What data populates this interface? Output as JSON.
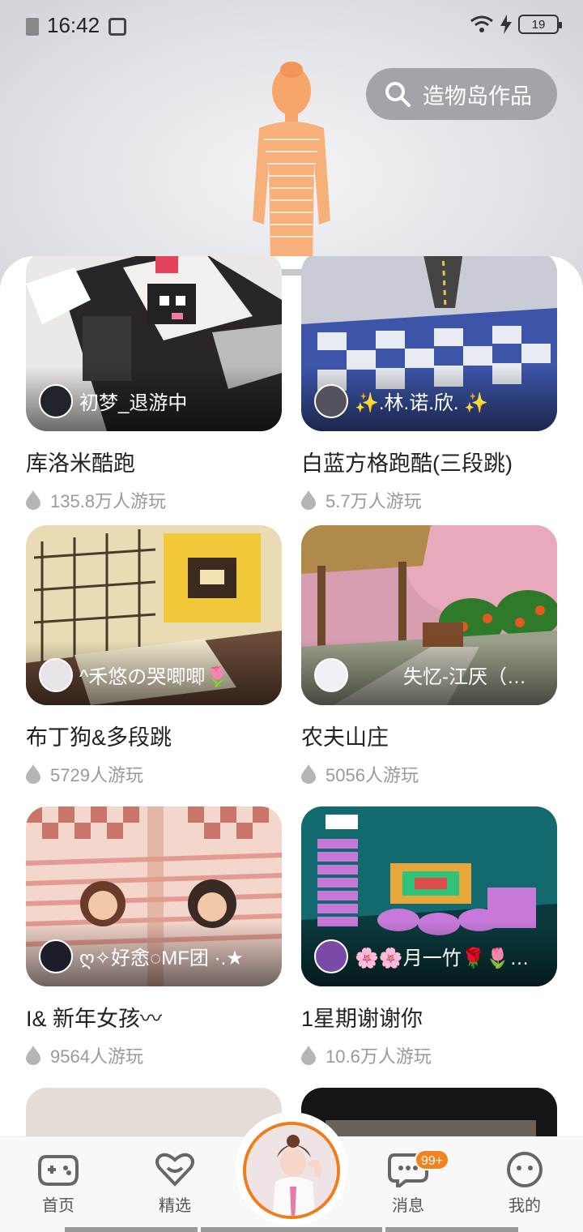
{
  "status_bar": {
    "time": "16:42",
    "battery": "19"
  },
  "search": {
    "label": "造物岛作品"
  },
  "cards": [
    {
      "title": "库洛米酷跑",
      "author": "初梦_退游中",
      "plays": "135.8万人游玩"
    },
    {
      "title": "白蓝方格跑酷(三段跳)",
      "author": "✨.林.诺.欣. ✨",
      "plays": "5.7万人游玩"
    },
    {
      "title": "布丁狗&多段跳",
      "author": "^禾悠の哭唧唧🌷",
      "plays": "5729人游玩"
    },
    {
      "title": "农夫山庄",
      "author": "失忆-江厌（…",
      "plays": "5056人游玩"
    },
    {
      "title": "I& 新年女孩〰",
      "author": "ღ✧好悆◌MF团 ·.★",
      "plays": "9564人游玩"
    },
    {
      "title": "1星期谢谢你",
      "author": "🌸🌸月一竹🌹🌷…",
      "plays": "10.6万人游玩"
    }
  ],
  "nav": {
    "home": "首页",
    "featured": "精选",
    "messages": "消息",
    "messages_badge": "99+",
    "mine": "我的"
  },
  "colors": {
    "accent": "#f07d1c",
    "badge": "#f58220"
  }
}
